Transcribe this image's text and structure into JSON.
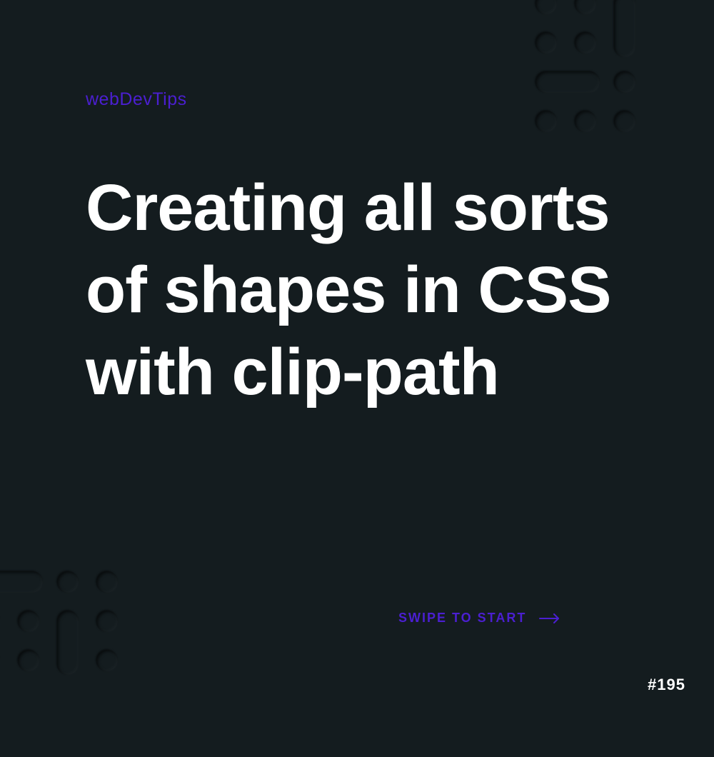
{
  "brand": "webDevTips",
  "title": "Creating all sorts of shapes in CSS with clip-path",
  "swipe_label": "SWIPE TO START",
  "post_number": "#195",
  "colors": {
    "background": "#141c1f",
    "accent": "#4b1fd1",
    "text": "#ffffff"
  }
}
